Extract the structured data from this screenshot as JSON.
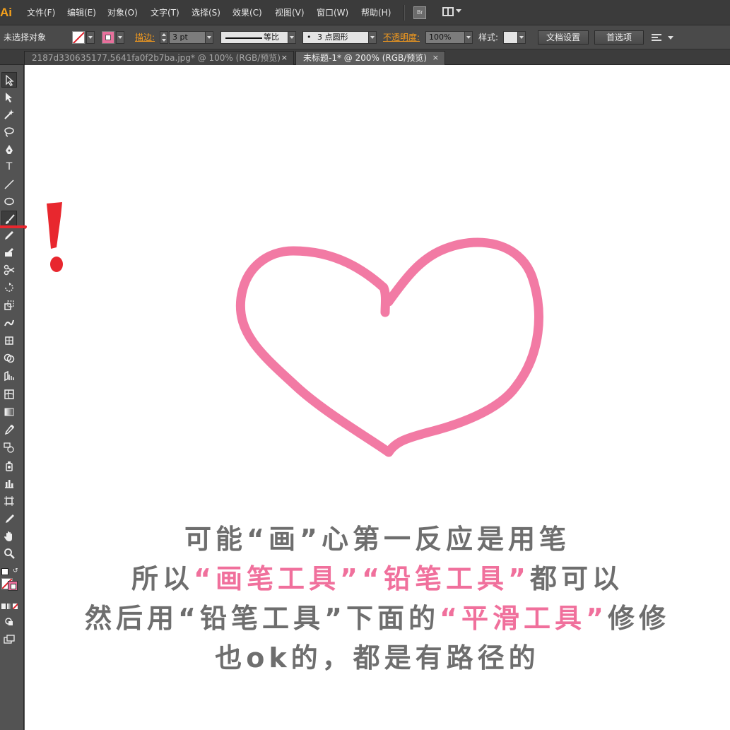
{
  "app": {
    "logo": "Ai",
    "menus": [
      "文件(F)",
      "编辑(E)",
      "对象(O)",
      "文字(T)",
      "选择(S)",
      "效果(C)",
      "视图(V)",
      "窗口(W)",
      "帮助(H)"
    ],
    "bridge_label": "Br"
  },
  "control_bar": {
    "selection_status": "未选择对象",
    "stroke_label": "描边:",
    "stroke_weight": "3 pt",
    "profile_label": "等比",
    "brush_label": "3 点圆形",
    "brush_dot": "•",
    "opacity_label": "不透明度:",
    "opacity_value": "100%",
    "style_label": "样式:",
    "doc_setup_button": "文档设置",
    "preferences_button": "首选项",
    "colors": {
      "fill": "none",
      "stroke": "#e8709c",
      "accent_label": "#f39a1e"
    }
  },
  "tabs": [
    {
      "label": "2187d330635177.5641fa0f2b7ba.jpg* @ 100% (RGB/预览)",
      "active": false,
      "close": "×"
    },
    {
      "label": "未标题-1* @ 200% (RGB/预览)",
      "active": true,
      "close": "×"
    }
  ],
  "tools": [
    "selection-tool",
    "direct-selection-tool",
    "magic-wand-tool",
    "lasso-tool",
    "pen-tool",
    "type-tool",
    "line-segment-tool",
    "ellipse-tool",
    "paintbrush-tool",
    "pencil-tool",
    "blob-brush-tool",
    "scissors-tool",
    "rotate-tool",
    "scale-tool",
    "warp-tool",
    "free-transform-tool",
    "shape-builder-tool",
    "perspective-grid-tool",
    "mesh-tool",
    "gradient-tool",
    "eyedropper-tool",
    "blend-tool",
    "symbol-sprayer-tool",
    "column-graph-tool",
    "artboard-tool",
    "slice-tool",
    "hand-tool",
    "zoom-tool"
  ],
  "type_tool_glyph": "T",
  "canvas": {
    "heart_color": "#f27aa4",
    "annotation_color": "#e8272e",
    "caption": {
      "line1": "可能“画”心第一反应是用笔",
      "line2_pre": "所以",
      "line2_pink1": "“画笔工具”",
      "line2_pink2": "“铅笔工具”",
      "line2_post": "都可以",
      "line3_pre": "然后用“铅笔工具”下面的",
      "line3_pink": "“平滑工具”",
      "line3_post": "修修",
      "line4": "也ok的，都是有路径的"
    }
  }
}
